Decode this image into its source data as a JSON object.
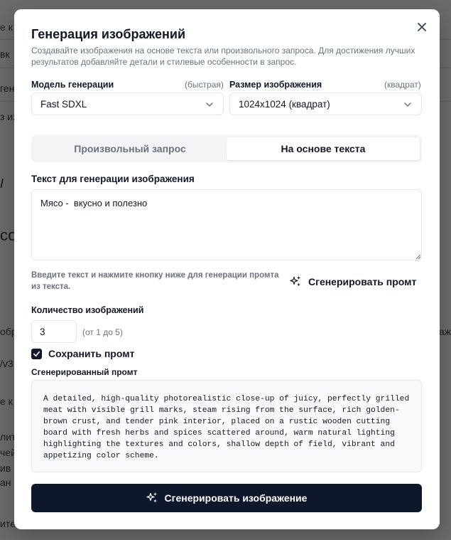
{
  "background": {
    "fragments_left": [
      "е к",
      "вк",
      "ген",
      "з из",
      "I",
      "со",
      "обра",
      "/v3.",
      "е к",
      "лит",
      "чей",
      "ив",
      "ан",
      "ите"
    ],
    "fragments_right": [
      "аж"
    ]
  },
  "modal": {
    "title": "Генерация изображений",
    "subtitle": "Создавайте изображения на основе текста или произвольного запроса. Для достижения лучших результатов добавляйте детали и стилевые особенности в запрос.",
    "close_icon": "close-icon"
  },
  "model": {
    "label": "Модель генерации",
    "hint": "(быстрая)",
    "value": "Fast SDXL"
  },
  "size": {
    "label": "Размер изображения",
    "hint": "(квадрат)",
    "value": "1024x1024 (квадрат)"
  },
  "tabs": [
    {
      "label": "Произвольный запрос",
      "active": false
    },
    {
      "label": "На основе текста",
      "active": true
    }
  ],
  "text_input": {
    "label": "Текст для генерации изображения",
    "value": "Мясо -  вкусно и полезно"
  },
  "helper_text": "Введите текст и нажмите кнопку ниже для генерации промта из текста.",
  "generate_prompt_button": "Сгенерировать промт",
  "count": {
    "label": "Количество изображений",
    "value": "3",
    "range": "(от 1 до 5)"
  },
  "save_prompt": {
    "label": "Сохранить промт",
    "checked": true
  },
  "generated_prompt": {
    "label": "Сгенерированный промт",
    "text": "A detailed, high-quality photorealistic close-up of juicy, perfectly grilled meat with visible grill marks, steam rising from the surface, rich golden-brown crust, and tender pink interior, placed on a rustic wooden cutting board with fresh herbs and spices scattered around, warm natural lighting highlighting the textures and colors, shallow depth of field, vibrant and appetizing color scheme."
  },
  "generate_image_button": "Сгенерировать изображение",
  "colors": {
    "primary": "#0f172a",
    "muted_text": "#6b7280",
    "border": "#e5e7eb"
  }
}
